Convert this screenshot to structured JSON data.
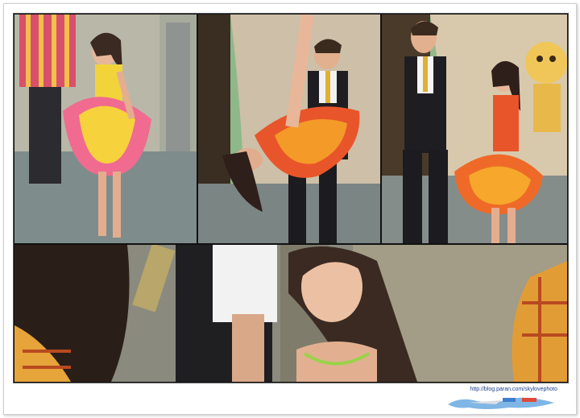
{
  "watermark": {
    "url": "http://blog.paran.com/skylovephoto"
  },
  "colors": {
    "frame_border": "#cfcfcf",
    "sheet_border": "#555555",
    "url_text": "#1d3f8a"
  }
}
